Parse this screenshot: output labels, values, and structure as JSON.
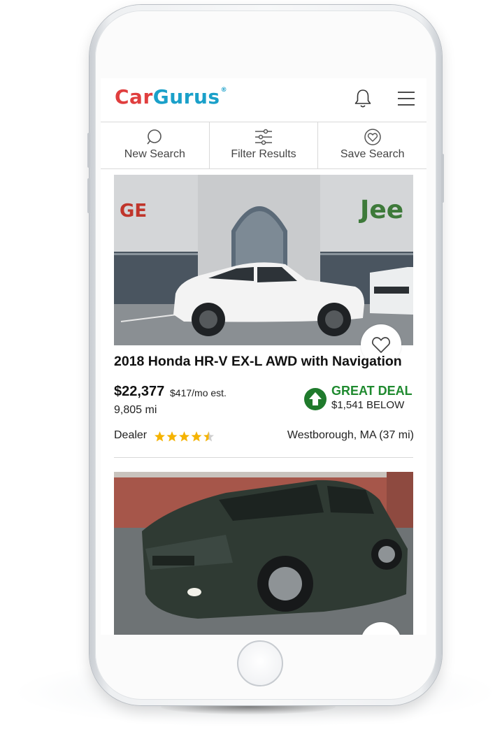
{
  "app": {
    "logo_car": "Car",
    "logo_gurus": "Gurus",
    "logo_mark": "®"
  },
  "toolbar": {
    "new_search": "New Search",
    "filter_results": "Filter Results",
    "save_search": "Save Search"
  },
  "listing1": {
    "title": "2018 Honda HR-V EX-L AWD with Navigation",
    "price": "$22,377",
    "monthly": "$417/mo est.",
    "mileage": "9,805 mi",
    "deal_label": "GREAT DEAL",
    "deal_below": "$1,541 BELOW",
    "seller_type": "Dealer",
    "rating": 4.5,
    "location": "Westborough, MA (37 mi)"
  },
  "colors": {
    "brand_red": "#e03e3e",
    "brand_blue": "#1aa0c9",
    "deal_green": "#1f8a2f",
    "star_gold": "#f5b301"
  },
  "icons": [
    "bell-icon",
    "menu-icon",
    "search-icon",
    "filter-icon",
    "save-heart-icon",
    "favorite-heart-icon",
    "deal-arrow-icon",
    "star-icon"
  ]
}
